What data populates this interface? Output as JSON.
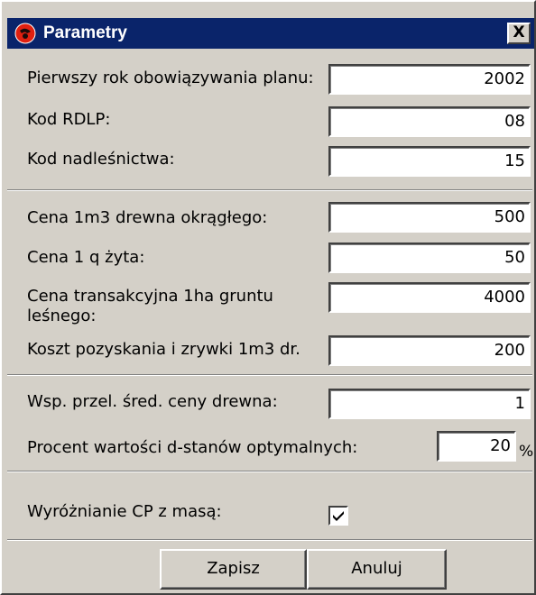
{
  "window": {
    "title": "Parametry",
    "close_label": "X",
    "app_icon": "red-circle-app-icon",
    "titlebar_color": "#0a246a"
  },
  "section1": {
    "first_year_label": "Pierwszy rok obowiązywania planu:",
    "first_year_value": "2002",
    "rdlp_label": "Kod RDLP:",
    "rdlp_value": "08",
    "nadlesnictwo_label": "Kod nadleśnictwa:",
    "nadlesnictwo_value": "15"
  },
  "section2": {
    "wood_price_label": "Cena 1m3 drewna okrągłego:",
    "wood_price_value": "500",
    "rye_price_label": "Cena 1 q żyta:",
    "rye_price_value": "50",
    "land_price_label": "Cena transakcyjna 1ha gruntu leśnego:",
    "land_price_value": "4000",
    "harvest_cost_label": "Koszt pozyskania i zrywki 1m3 dr.",
    "harvest_cost_value": "200"
  },
  "section3": {
    "conversion_label": "Wsp. przel. śred. ceny drewna:",
    "conversion_value": "1",
    "percent_label": "Procent wartości d-stanów optymalnych:",
    "percent_value": "20",
    "percent_sign": "%"
  },
  "section4": {
    "highlight_label": "Wyróżnianie CP z masą:",
    "highlight_checked": true
  },
  "buttons": {
    "save_label": "Zapisz",
    "cancel_label": "Anuluj"
  }
}
